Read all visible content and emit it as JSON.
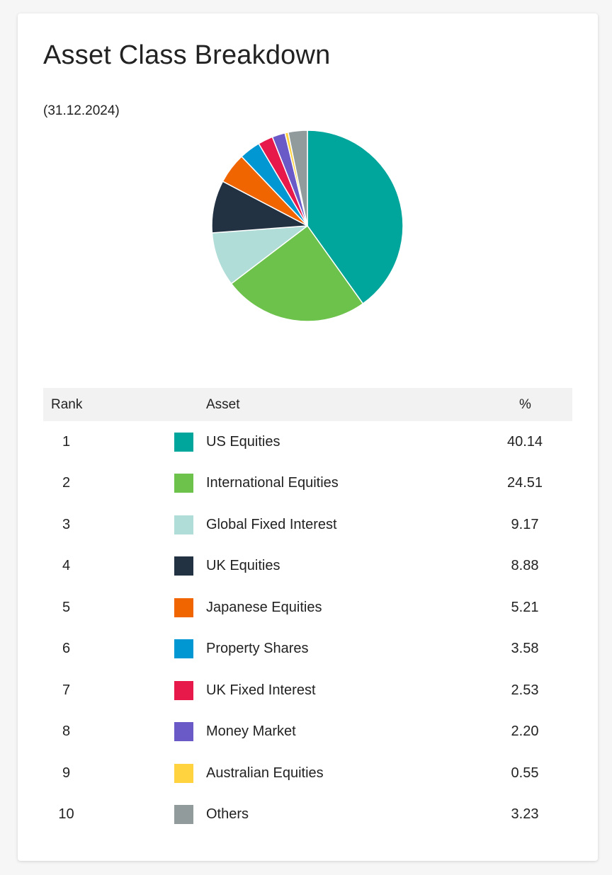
{
  "card": {
    "title": "Asset Class Breakdown",
    "date": "(31.12.2024)"
  },
  "table": {
    "headers": {
      "rank": "Rank",
      "asset": "Asset",
      "pct": "%"
    },
    "rows": [
      {
        "rank": "1",
        "asset": "US Equities",
        "pct": "40.14",
        "color": "#00a59b"
      },
      {
        "rank": "2",
        "asset": "International Equities",
        "pct": "24.51",
        "color": "#6cc24a"
      },
      {
        "rank": "3",
        "asset": "Global Fixed Interest",
        "pct": "9.17",
        "color": "#b1ddd8"
      },
      {
        "rank": "4",
        "asset": "UK Equities",
        "pct": "8.88",
        "color": "#233243"
      },
      {
        "rank": "5",
        "asset": "Japanese Equities",
        "pct": "5.21",
        "color": "#f06500"
      },
      {
        "rank": "6",
        "asset": "Property Shares",
        "pct": "3.58",
        "color": "#0097d3"
      },
      {
        "rank": "7",
        "asset": "UK Fixed Interest",
        "pct": "2.53",
        "color": "#e6194a"
      },
      {
        "rank": "8",
        "asset": "Money Market",
        "pct": "2.20",
        "color": "#6a5ac7"
      },
      {
        "rank": "9",
        "asset": "Australian Equities",
        "pct": "0.55",
        "color": "#ffd23f"
      },
      {
        "rank": "10",
        "asset": "Others",
        "pct": "3.23",
        "color": "#919b9c"
      }
    ]
  },
  "chart_data": {
    "type": "pie",
    "categories": [
      "US Equities",
      "International Equities",
      "Global Fixed Interest",
      "UK Equities",
      "Japanese Equities",
      "Property Shares",
      "UK Fixed Interest",
      "Money Market",
      "Australian Equities",
      "Others"
    ],
    "values": [
      40.14,
      24.51,
      9.17,
      8.88,
      5.21,
      3.58,
      2.53,
      2.2,
      0.55,
      3.23
    ],
    "colors": [
      "#00a59b",
      "#6cc24a",
      "#b1ddd8",
      "#233243",
      "#f06500",
      "#0097d3",
      "#e6194a",
      "#6a5ac7",
      "#ffd23f",
      "#919b9c"
    ],
    "title": "Asset Class Breakdown",
    "subtitle": "(31.12.2024)",
    "start_angle": "top",
    "direction": "clockwise"
  }
}
